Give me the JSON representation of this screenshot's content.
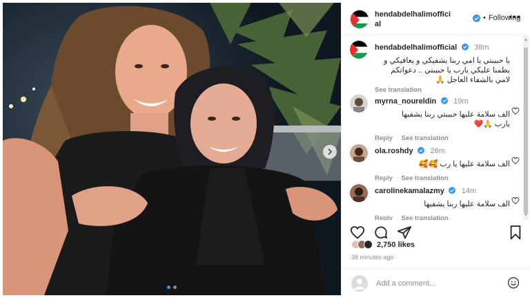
{
  "post": {
    "account": "hendabdelhalimofficial",
    "header_name_line1": "hendabdelhalimoffici",
    "header_name_line2": "al",
    "follow_status": "Following",
    "more_label": "•••",
    "caption": {
      "username": "hendabdelhalimofficial",
      "time": "38m",
      "text_line1": "يا حبيبتي يا امي ربنا يشفيكي و يعافيكي و",
      "text_line2": "يطمنا عليكي يارب يا حبيبتي .. دعواتكم",
      "text_line3": "لامي بالشفاء العاجل 🙏",
      "see_translation": "See translation"
    },
    "comments": [
      {
        "username": "myrna_noureldin",
        "time": "19m",
        "text_line1": "الف سلامة عليها حبيبتي ربنا يشفيها",
        "text_line2": "يارب 🙏❤️",
        "reply": "Reply",
        "see_translation": "See translation"
      },
      {
        "username": "ola.roshdy",
        "time": "26m",
        "text_line1": "الف سلامة عليها يا رب 🥰🥰",
        "reply": "Reply",
        "see_translation": "See translation"
      },
      {
        "username": "carolinekamalazmy",
        "time": "14m",
        "text_line1": "الف سلامة عليها ربنا يشفيها",
        "reply": "Reply",
        "see_translation": "See translation"
      }
    ],
    "likes": "2,750 likes",
    "posted_ago": "38 minutes ago",
    "add_comment_placeholder": "Add a comment...",
    "carousel": {
      "current_slide": 1,
      "total_slides": 2
    }
  },
  "colors": {
    "verified": "#3897f0",
    "flag_black": "#000000",
    "flag_white": "#ffffff",
    "flag_green": "#149954",
    "flag_red": "#e4312b",
    "heart_red": "#ed4956"
  },
  "icons": [
    "verified-icon",
    "heart-icon",
    "comment-icon",
    "share-icon",
    "bookmark-icon",
    "emoji-icon",
    "chevron-right-icon"
  ]
}
